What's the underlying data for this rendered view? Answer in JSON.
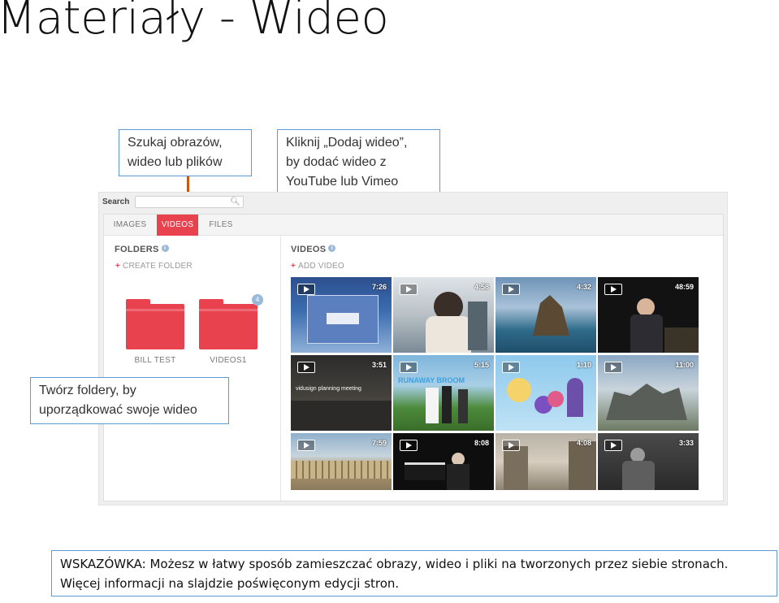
{
  "slide": {
    "title": "Materiały - Wideo"
  },
  "callouts": {
    "search": "Szukaj obrazów,\nwideo lub plików",
    "add_video": "Kliknij „Dodaj wideo”,\nby dodać wideo z\nYouTube lub Vimeo",
    "folders": "Twórz foldery, by\nuporządkować swoje wideo"
  },
  "app": {
    "search_label": "Search",
    "search_placeholder": "",
    "tabs": [
      {
        "label": "IMAGES",
        "active": false
      },
      {
        "label": "VIDEOS",
        "active": true
      },
      {
        "label": "FILES",
        "active": false
      }
    ],
    "folders_heading": "FOLDERS",
    "create_folder": "CREATE FOLDER",
    "videos_heading": "VIDEOS",
    "add_video": "ADD VIDEO",
    "folders": [
      {
        "name": "BILL TEST",
        "badge": ""
      },
      {
        "name": "VIDEOS1",
        "badge": "4"
      }
    ],
    "videos": [
      {
        "duration": "7:26",
        "caption": ""
      },
      {
        "duration": "4:58",
        "caption": ""
      },
      {
        "duration": "4:32",
        "caption": ""
      },
      {
        "duration": "48:59",
        "caption": ""
      },
      {
        "duration": "3:51",
        "caption": "vidusign planning meeting"
      },
      {
        "duration": "5:15",
        "caption": "RUNAWAY BROOM"
      },
      {
        "duration": "1:10",
        "caption": ""
      },
      {
        "duration": "11:00",
        "caption": ""
      },
      {
        "duration": "7:59",
        "caption": ""
      },
      {
        "duration": "8:08",
        "caption": ""
      },
      {
        "duration": "4:08",
        "caption": ""
      },
      {
        "duration": "3:33",
        "caption": ""
      }
    ],
    "accent_color": "#e8424f"
  },
  "tip": {
    "line1": "WSKAZÓWKA: Możesz w łatwy sposób zamieszczać obrazy, wideo i pliki na tworzonych przez siebie stronach.",
    "line2": "Więcej informacji na slajdzie poświęconym edycji stron."
  }
}
